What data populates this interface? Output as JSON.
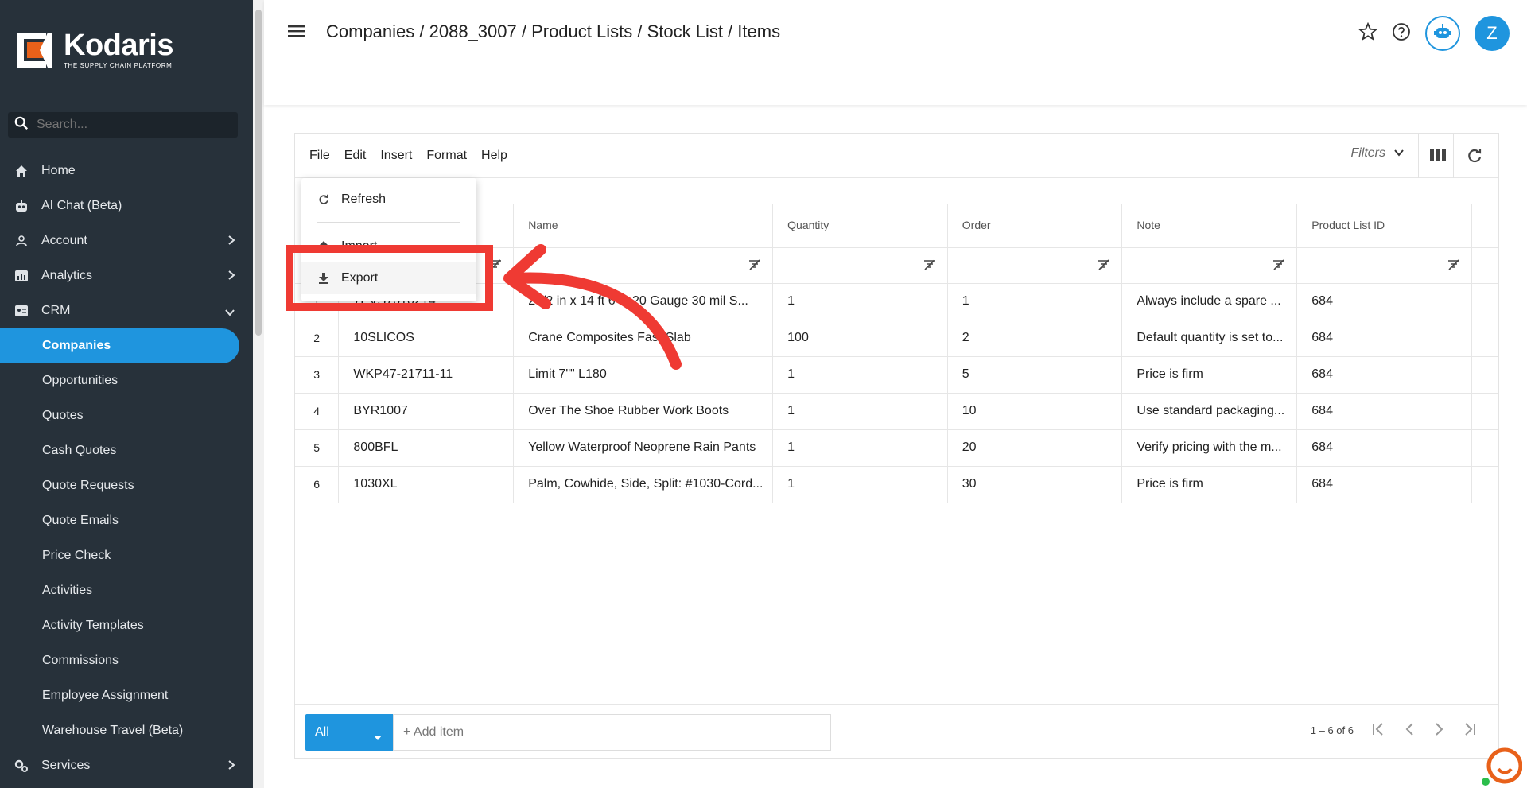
{
  "sidebar": {
    "brand": "Kodaris",
    "tagline": "THE SUPPLY CHAIN PLATFORM",
    "search_placeholder": "Search...",
    "items": [
      {
        "label": "Home",
        "icon": "home-icon"
      },
      {
        "label": "AI Chat (Beta)",
        "icon": "robot-icon"
      },
      {
        "label": "Account",
        "icon": "user-icon"
      },
      {
        "label": "Analytics",
        "icon": "chart-icon"
      },
      {
        "label": "CRM",
        "icon": "crm-icon"
      },
      {
        "label": "Companies"
      },
      {
        "label": "Opportunities"
      },
      {
        "label": "Quotes"
      },
      {
        "label": "Cash Quotes"
      },
      {
        "label": "Quote Requests"
      },
      {
        "label": "Quote Emails"
      },
      {
        "label": "Price Check"
      },
      {
        "label": "Activities"
      },
      {
        "label": "Activity Templates"
      },
      {
        "label": "Commissions"
      },
      {
        "label": "Employee Assignment"
      },
      {
        "label": "Warehouse Travel (Beta)"
      },
      {
        "label": "Services",
        "icon": "gears-icon"
      }
    ],
    "active_item": "Companies"
  },
  "header": {
    "breadcrumb": "Companies / 2088_3007 / Product Lists / Stock List / Items",
    "avatar_initial": "Z"
  },
  "menubar": {
    "file": "File",
    "edit": "Edit",
    "insert": "Insert",
    "format": "Format",
    "help": "Help",
    "filters": "Filters"
  },
  "dropdown": {
    "refresh": "Refresh",
    "import": "Import",
    "export": "Export"
  },
  "table": {
    "columns": [
      "Name",
      "Quantity",
      "Order",
      "Note",
      "Product List ID"
    ],
    "rows": [
      {
        "num": "1",
        "code": "7PVS7010214",
        "name": "20/2 in x 14 ft 6 in 20 Gauge 30 mil S...",
        "qty": "1",
        "order": "1",
        "note": "Always include a spare ...",
        "plid": "684"
      },
      {
        "num": "2",
        "code": "10SLICOS",
        "name": "Crane Composites Fast Slab",
        "qty": "100",
        "order": "2",
        "note": "Default quantity is set to...",
        "plid": "684"
      },
      {
        "num": "3",
        "code": "WKP47-21711-11",
        "name": "Limit 7\"\" L180",
        "qty": "1",
        "order": "5",
        "note": "Price is firm",
        "plid": "684"
      },
      {
        "num": "4",
        "code": "BYR1007",
        "name": "Over The Shoe Rubber Work Boots",
        "qty": "1",
        "order": "10",
        "note": "Use standard packaging...",
        "plid": "684"
      },
      {
        "num": "5",
        "code": "800BFL",
        "name": "Yellow Waterproof Neoprene Rain Pants",
        "qty": "1",
        "order": "20",
        "note": "Verify pricing with the m...",
        "plid": "684"
      },
      {
        "num": "6",
        "code": "1030XL",
        "name": "Palm, Cowhide, Side, Split: #1030-Cord...",
        "qty": "1",
        "order": "30",
        "note": "Price is firm",
        "plid": "684"
      }
    ]
  },
  "footer": {
    "scope": "All",
    "add_item": "+ Add item",
    "pagination": "1 – 6 of 6"
  },
  "colors": {
    "sidebar_bg": "#27313a",
    "accent": "#1f95de",
    "annotation": "#ef3a33"
  }
}
